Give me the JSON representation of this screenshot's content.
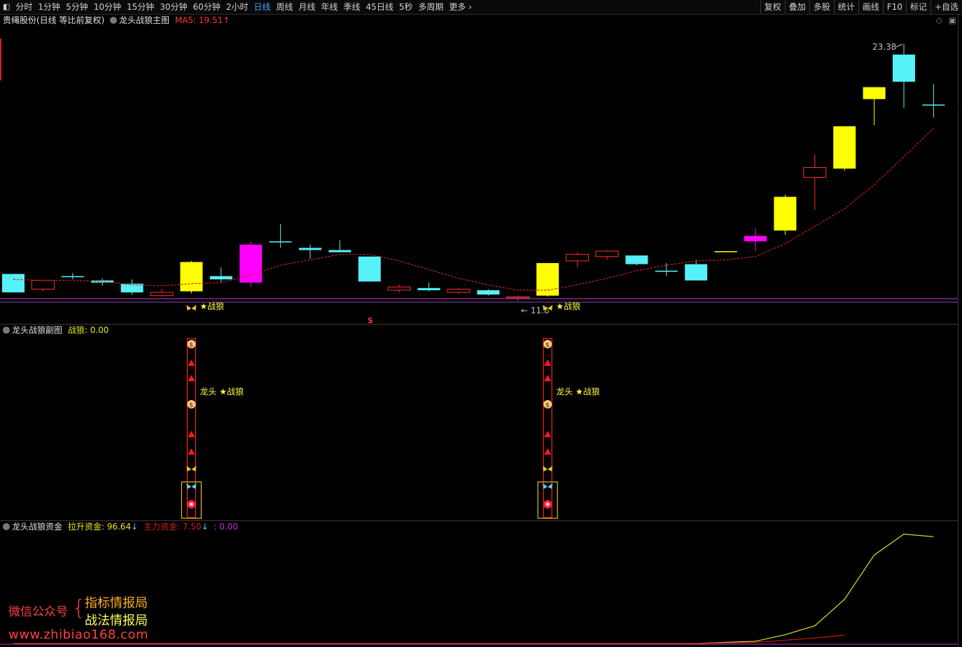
{
  "toolbar": {
    "timeframes": [
      "分时",
      "1分钟",
      "5分钟",
      "10分钟",
      "15分钟",
      "30分钟",
      "60分钟",
      "2小时",
      "日线",
      "周线",
      "月线",
      "年线",
      "季线",
      "45日线",
      "5秒",
      "多周期",
      "更多"
    ],
    "active_index": 8,
    "right_buttons": [
      "复权",
      "叠加",
      "多股",
      "统计",
      "画线",
      "F10",
      "标记",
      "+自选"
    ]
  },
  "main_panel": {
    "title": "贵绳股份(日线 等比前复权)",
    "indicator": "龙头战狼主图",
    "ma_label": "MA5: 19.51",
    "ma_arrow": "↑",
    "high_label": "23.38",
    "low_label": "11.8",
    "signal_text": "★战狼",
    "s_marker": "S"
  },
  "sub_panel": {
    "indicator": "龙头战狼副图",
    "label": "战狼",
    "value": "0.00",
    "signal_text": "龙头 ★战狼"
  },
  "fund_panel": {
    "indicator": "龙头战狼资金",
    "lift_label": "拉升资金",
    "lift_value": "96.64",
    "lift_arrow": "↓",
    "main_label": "主力资金",
    "main_value": "7.50",
    "main_arrow": "↓",
    "other_value": ": 0.00"
  },
  "watermark": {
    "line1": "微信公众号",
    "brace": "{",
    "item1": "指标情报局",
    "item2": "战法情报局",
    "url": "www.zhibiao168.com"
  },
  "colors": {
    "up_cyan": "#55f0f8",
    "yellow": "#ffff00",
    "magenta": "#ff00ff",
    "down_red": "#ff3030",
    "ma": "#d02020"
  },
  "chart_data": [
    {
      "type": "candlestick",
      "title": "龙头战狼主图",
      "columns": [
        "open",
        "high",
        "low",
        "close",
        "color"
      ],
      "candles": [
        [
          11.95,
          12.8,
          11.95,
          12.8,
          "cyan"
        ],
        [
          12.5,
          12.5,
          12.0,
          12.1,
          "red"
        ],
        [
          12.7,
          12.85,
          12.55,
          12.65,
          "cyan"
        ],
        [
          12.5,
          12.6,
          12.25,
          12.4,
          "cyan"
        ],
        [
          12.35,
          12.55,
          11.85,
          11.95,
          "cyan"
        ],
        [
          11.8,
          12.1,
          11.75,
          11.95,
          "red"
        ],
        [
          12.0,
          13.4,
          11.9,
          13.35,
          "yellow"
        ],
        [
          12.7,
          13.1,
          12.4,
          12.55,
          "cyan"
        ],
        [
          12.4,
          14.3,
          12.2,
          14.15,
          "magenta"
        ],
        [
          14.3,
          15.1,
          14.0,
          14.25,
          "cyan"
        ],
        [
          14.0,
          14.15,
          13.5,
          13.9,
          "cyan"
        ],
        [
          13.9,
          14.35,
          13.8,
          13.8,
          "cyan"
        ],
        [
          13.6,
          13.6,
          12.45,
          12.45,
          "cyan"
        ],
        [
          12.05,
          12.3,
          11.95,
          12.2,
          "red"
        ],
        [
          12.05,
          12.4,
          12.0,
          12.15,
          "cyan"
        ],
        [
          12.1,
          12.15,
          11.9,
          11.95,
          "red"
        ],
        [
          12.05,
          12.1,
          11.8,
          11.85,
          "cyan"
        ],
        [
          11.7,
          11.8,
          11.55,
          11.75,
          "red"
        ],
        [
          11.8,
          13.3,
          11.75,
          13.3,
          "yellow"
        ],
        [
          13.4,
          13.8,
          13.1,
          13.7,
          "red"
        ],
        [
          13.6,
          13.9,
          13.45,
          13.85,
          "red"
        ],
        [
          13.65,
          13.65,
          13.2,
          13.25,
          "cyan"
        ],
        [
          12.9,
          13.3,
          12.7,
          12.95,
          "cyan"
        ],
        [
          12.5,
          13.45,
          12.5,
          13.25,
          "cyan"
        ],
        [
          13.85,
          13.85,
          13.85,
          13.85,
          "yellow"
        ],
        [
          14.3,
          14.9,
          13.85,
          14.55,
          "magenta"
        ],
        [
          14.8,
          16.45,
          14.6,
          16.35,
          "yellow"
        ],
        [
          17.25,
          18.3,
          15.75,
          17.7,
          "red"
        ],
        [
          17.65,
          19.6,
          17.55,
          19.6,
          "yellow"
        ],
        [
          20.85,
          21.4,
          19.65,
          21.4,
          "yellow"
        ],
        [
          21.65,
          23.38,
          20.45,
          22.9,
          "cyan"
        ],
        [
          20.6,
          21.55,
          20.0,
          20.6,
          "cyan"
        ]
      ],
      "ma5": [
        12.55,
        12.5,
        12.5,
        12.45,
        12.3,
        12.25,
        12.35,
        12.4,
        12.75,
        13.2,
        13.45,
        13.7,
        13.7,
        13.4,
        13.0,
        12.6,
        12.3,
        12.05,
        12.05,
        12.3,
        12.6,
        12.95,
        13.2,
        13.4,
        13.45,
        13.6,
        14.2,
        15.0,
        15.8,
        16.9,
        18.2,
        19.51
      ],
      "annotations": {
        "high": 23.38,
        "low": 11.8
      },
      "grid": false
    },
    {
      "type": "signal_columns",
      "title": "龙头战狼副图",
      "signal_candle_index": [
        6,
        18
      ],
      "value": 0.0
    },
    {
      "type": "line",
      "title": "龙头战狼资金",
      "series": [
        {
          "name": "拉升资金",
          "values": [
            0,
            0,
            0,
            0,
            0,
            0,
            0,
            0,
            0,
            0,
            0,
            0,
            0,
            0,
            0,
            0,
            0,
            0,
            0,
            0,
            0,
            0,
            0,
            0,
            1,
            2,
            8,
            16,
            40,
            80,
            99,
            96.64
          ],
          "color": "#e0e020"
        },
        {
          "name": "主力资金",
          "values": [
            0,
            0,
            0,
            0,
            0,
            0,
            0,
            0,
            0,
            0,
            0,
            0,
            0,
            0,
            0,
            0,
            0,
            0,
            0,
            0,
            0,
            0,
            0,
            0,
            0.5,
            1,
            3,
            5,
            7.5
          ],
          "color": "#c01818"
        }
      ]
    }
  ]
}
